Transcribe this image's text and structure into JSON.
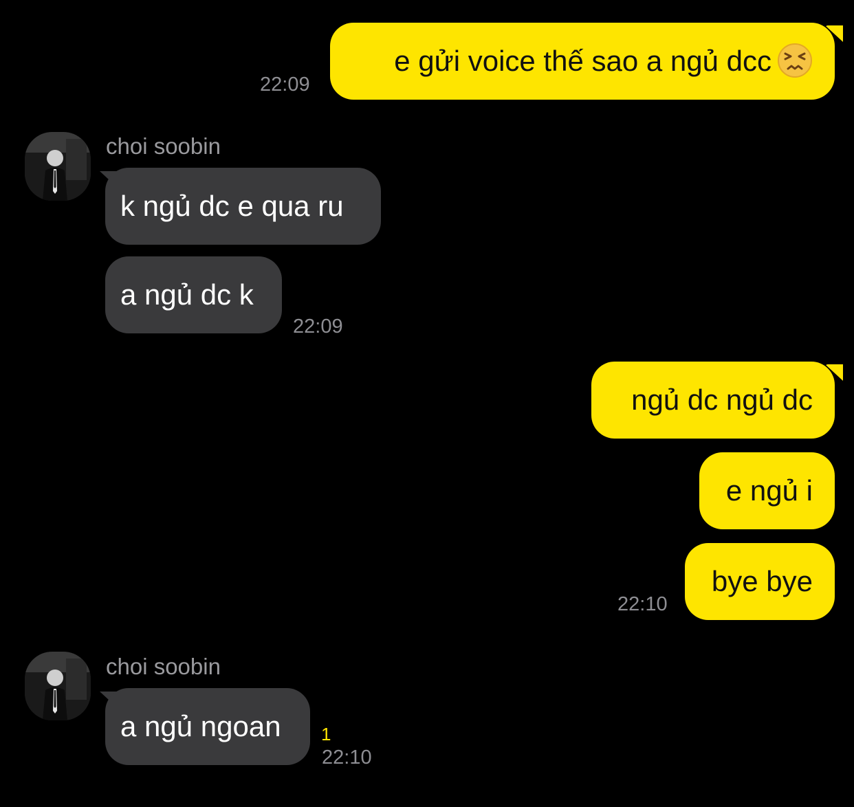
{
  "contact": {
    "name": "choi soobin"
  },
  "messages": [
    {
      "side": "out",
      "text": "e gửi voice thế sao a ngủ dcc",
      "emoji": "persevering-face-icon",
      "time": "22:09"
    },
    {
      "side": "in",
      "text": "k ngủ dc e qua ru"
    },
    {
      "side": "in",
      "text": "a ngủ dc k",
      "time": "22:09"
    },
    {
      "side": "out",
      "text": "ngủ dc ngủ dc"
    },
    {
      "side": "out",
      "text": "e ngủ i"
    },
    {
      "side": "out",
      "text": "bye bye",
      "time": "22:10"
    },
    {
      "side": "in",
      "text": "a ngủ ngoan",
      "time": "22:10",
      "unread": "1"
    }
  ],
  "colors": {
    "background": "#000000",
    "outgoing_bubble": "#FEE500",
    "incoming_bubble": "#3a3a3c",
    "timestamp": "#8e8e93",
    "unread_count": "#FEE500"
  }
}
